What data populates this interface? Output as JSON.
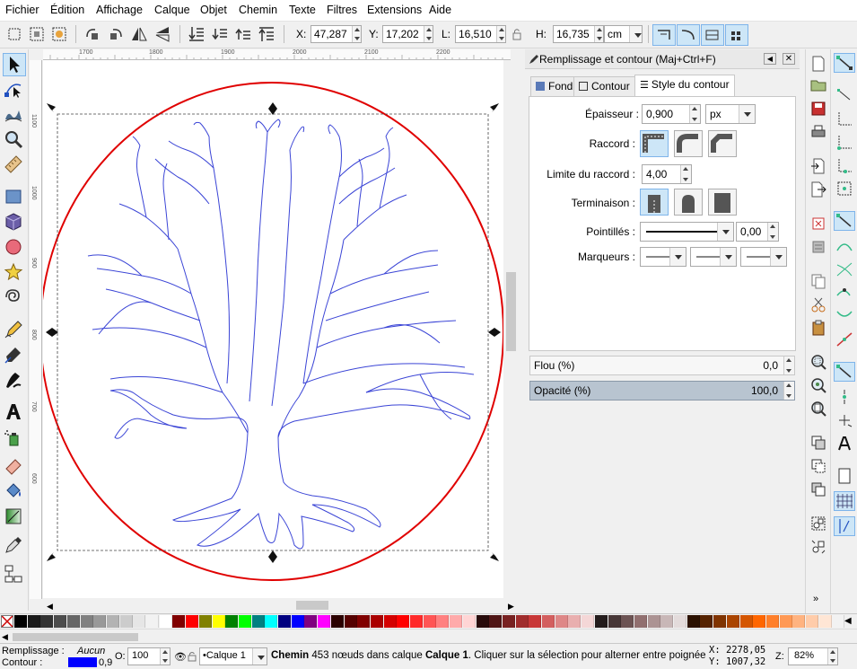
{
  "menu": [
    {
      "label": "Fichier"
    },
    {
      "label": "Édition"
    },
    {
      "label": "Affichage"
    },
    {
      "label": "Calque"
    },
    {
      "label": "Objet"
    },
    {
      "label": "Chemin"
    },
    {
      "label": "Texte"
    },
    {
      "label": "Filtres"
    },
    {
      "label": "Extensions"
    },
    {
      "label": "Aide"
    }
  ],
  "toolbar": {
    "x_label": "X:",
    "x_value": "47,287",
    "y_label": "Y:",
    "y_value": "17,202",
    "w_label": "L:",
    "w_value": "16,510",
    "h_label": "H:",
    "h_value": "16,735",
    "unit": "cm"
  },
  "ruler": {
    "top": [
      "1700",
      "1800",
      "1900",
      "2000",
      "2100",
      "2200"
    ],
    "left": [
      "1100",
      "1000",
      "900",
      "800",
      "700",
      "600"
    ]
  },
  "dialog": {
    "title": "Remplissage et contour (Maj+Ctrl+F)",
    "tabs": [
      {
        "label": "Fond",
        "active": false
      },
      {
        "label": "Contour",
        "active": false
      },
      {
        "label": "Style du contour",
        "active": true
      }
    ],
    "stroke_width_label": "Épaisseur :",
    "stroke_width_value": "0,900",
    "stroke_width_unit": "px",
    "join_label": "Raccord :",
    "miter_label": "Limite du raccord :",
    "miter_value": "4,00",
    "cap_label": "Terminaison :",
    "dashes_label": "Pointillés :",
    "dash_offset": "0,00",
    "markers_label": "Marqueurs :",
    "blur_label": "Flou (%)",
    "blur_value": "0,0",
    "opacity_label": "Opacité (%)",
    "opacity_value": "100,0"
  },
  "colors": {
    "accent": "#cde6f7",
    "selection_circle": "#e00000",
    "tree_stroke": "#3b45d6",
    "stroke_swatch": "#0000ff"
  },
  "palette": [
    "#000000",
    "#1a1a1a",
    "#333333",
    "#4d4d4d",
    "#666666",
    "#808080",
    "#999999",
    "#b3b3b3",
    "#cccccc",
    "#e6e6e6",
    "#f2f2f2",
    "#ffffff",
    "#800000",
    "#ff0000",
    "#808000",
    "#ffff00",
    "#008000",
    "#00ff00",
    "#008080",
    "#00ffff",
    "#000080",
    "#0000ff",
    "#800080",
    "#ff00ff",
    "#2b0000",
    "#550000",
    "#800000",
    "#aa0000",
    "#d40000",
    "#ff0000",
    "#ff2a2a",
    "#ff5555",
    "#ff8080",
    "#ffaaaa",
    "#ffd5d5",
    "#280b0b",
    "#501616",
    "#782121",
    "#a02c2c",
    "#c83737",
    "#d35f5f",
    "#de8787",
    "#e9afaf",
    "#f4d7d7",
    "#241c1c",
    "#483737",
    "#6c5353",
    "#916f6f",
    "#ac9393",
    "#c8b7b7",
    "#e3dbdb",
    "#2b1100",
    "#552200",
    "#803300",
    "#aa4400",
    "#d45500",
    "#ff6600",
    "#ff7f2a",
    "#ff9955",
    "#ffb380",
    "#ffccaa",
    "#ffe6d5",
    "#f2f2f2"
  ],
  "status": {
    "fill_label": "Remplissage :",
    "fill_value": "Aucun",
    "stroke_label": "Contour :",
    "stroke_width": "0,9",
    "opacity_label": "O:",
    "opacity_value": "100",
    "layer": "•Calque 1",
    "message_bold": "Chemin",
    "message_mid": " 453 nœuds dans calque ",
    "message_layer": "Calque 1",
    "message_end": ". Cliquer sur la sélection pour alterner entre poignées",
    "coord_x": "X: 2278,05",
    "coord_y": "Y: 1007,32",
    "zoom_label": "Z:",
    "zoom_value": "82%"
  }
}
